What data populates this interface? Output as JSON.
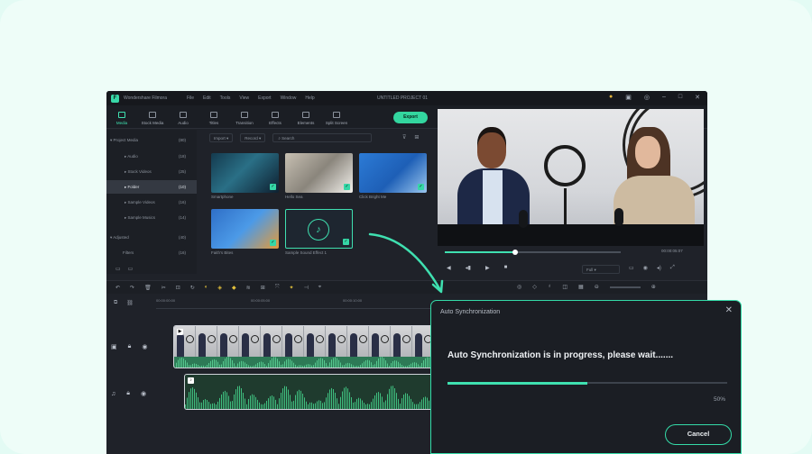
{
  "app": {
    "name": "Wondershare Filmora",
    "document_title": "UNTITLED PROJECT 01",
    "menu": [
      "File",
      "Edit",
      "Tools",
      "View",
      "Export",
      "Window",
      "Help"
    ]
  },
  "toolbar": {
    "tabs": [
      "Media",
      "Stock Media",
      "Audio",
      "Titles",
      "Transition",
      "Effects",
      "Elements",
      "Split Screen"
    ],
    "active_tab": "Media",
    "export_label": "Export"
  },
  "sidebar": {
    "items": [
      {
        "label": "Project Media",
        "count": "(80)"
      },
      {
        "label": "Audio",
        "count": "(18)"
      },
      {
        "label": "Stock Videos",
        "count": "(25)"
      },
      {
        "label": "Folder",
        "count": "(10)"
      },
      {
        "label": "Sample Videos",
        "count": "(16)"
      },
      {
        "label": "Sample Musics",
        "count": "(14)"
      },
      {
        "label": "Adjusted",
        "count": "(40)"
      },
      {
        "label": "Filters",
        "count": "(16)"
      }
    ],
    "selected": "Folder"
  },
  "media_panel": {
    "import_label": "Import",
    "record_label": "Record",
    "search_placeholder": "Search",
    "items": [
      {
        "label": "Smartphone"
      },
      {
        "label": "Hello Sea"
      },
      {
        "label": "Click Bright Me"
      },
      {
        "label": "Faith's Bites"
      },
      {
        "label": "Sample Sound Effect 1"
      }
    ]
  },
  "player": {
    "timecode": "00:00:05:07",
    "quality": "Full",
    "progress": 0.4
  },
  "timeline": {
    "ticks": [
      "00:00:00:00",
      "00:00:05:00",
      "00:00:10:00"
    ]
  },
  "dialog": {
    "title": "Auto Synchronization",
    "message": "Auto Synchronization is in progress, please wait.......",
    "progress_percent": 50,
    "progress_text": "50%",
    "cancel_label": "Cancel"
  },
  "colors": {
    "accent": "#3fe0b0",
    "background": "#1f2229",
    "card": "#eefdf8"
  }
}
